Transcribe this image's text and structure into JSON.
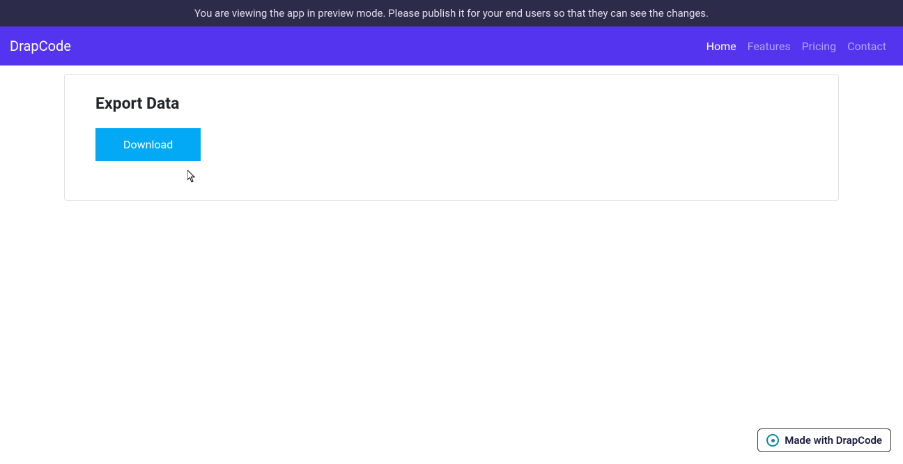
{
  "preview_banner": {
    "message": "You are viewing the app in preview mode. Please publish it for your end users so that they can see the changes."
  },
  "navbar": {
    "brand": "DrapCode",
    "links": [
      {
        "label": "Home",
        "active": true
      },
      {
        "label": "Features",
        "active": false
      },
      {
        "label": "Pricing",
        "active": false
      },
      {
        "label": "Contact",
        "active": false
      }
    ]
  },
  "card": {
    "title": "Export Data",
    "download_button_label": "Download"
  },
  "badge": {
    "text": "Made with DrapCode"
  }
}
